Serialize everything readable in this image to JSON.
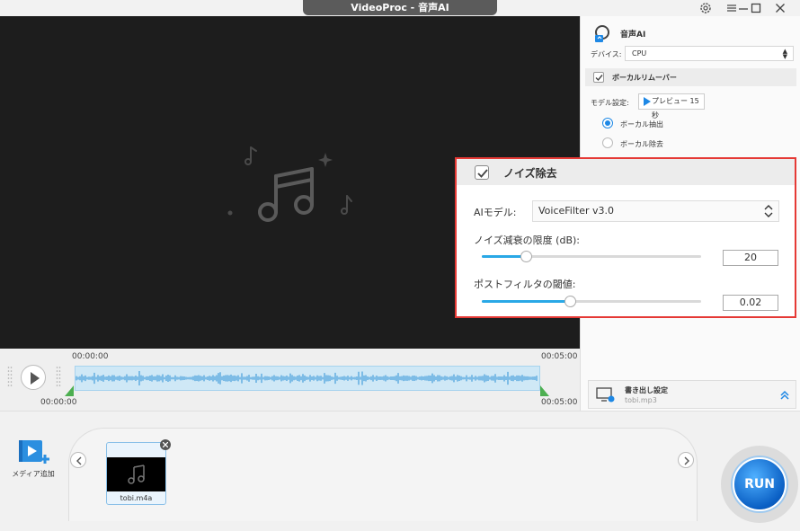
{
  "window": {
    "title": "VideoProc - 音声AI"
  },
  "timeline": {
    "start_top": "00:00:00",
    "end_top": "00:05:00",
    "start_bottom": "00:00:00",
    "end_bottom": "00:05:00"
  },
  "right_panel": {
    "title": "音声AI",
    "device_label": "デバイス:",
    "device_value": "CPU",
    "vocal_remover_label": "ボーカルリムーバー",
    "model_setting_label": "モデル設定:",
    "preview_button": "プレビュー 15秒",
    "option_extract": "ボーカル抽出",
    "option_remove": "ボーカル除去",
    "export_title": "書き出し設定",
    "export_file": "tobi.mp3"
  },
  "noise_panel": {
    "title": "ノイズ除去",
    "model_label": "AIモデル:",
    "model_value": "VoiceFilter v3.0",
    "limit_label": "ノイズ減衰の限度 (dB):",
    "limit_value": "20",
    "limit_fraction": 0.2,
    "threshold_label": "ポストフィルタの閾値:",
    "threshold_value": "0.02",
    "threshold_fraction": 0.4
  },
  "bottom": {
    "media_add_label": "メディア追加",
    "file_name": "tobi.m4a",
    "run_label": "RUN"
  },
  "colors": {
    "accent": "#1e88e5",
    "highlight_border": "#e53935",
    "slider_fill": "#29a8e6"
  }
}
